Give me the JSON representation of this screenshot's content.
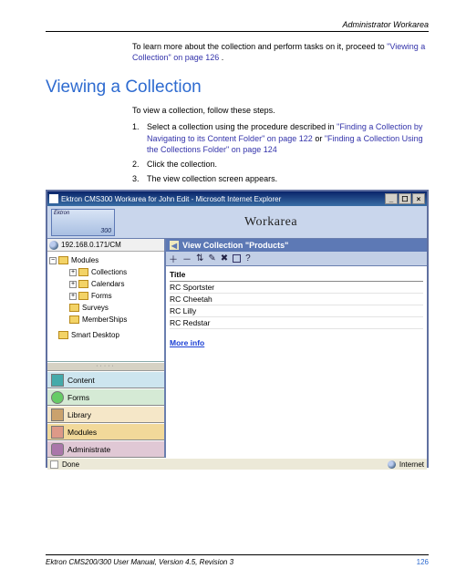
{
  "header": {
    "section": "Administrator Workarea"
  },
  "intro": {
    "prefix": "To learn more about the collection and perform tasks on it, proceed to ",
    "link": "\"Viewing a Collection\" on page 126",
    "suffix": "."
  },
  "heading": "Viewing a Collection",
  "lead": "To view a collection, follow these steps.",
  "steps": [
    {
      "num": "1.",
      "pre": "Select a collection using the procedure described in ",
      "link1": "\"Finding a Collection by Navigating to its Content Folder\" on page 122",
      "mid": " or ",
      "link2": "\"Finding a Collection Using the Collections Folder\" on page 124"
    },
    {
      "num": "2.",
      "text": "Click the collection."
    },
    {
      "num": "3.",
      "text": "The view collection screen appears."
    }
  ],
  "window": {
    "title": "Ektron CMS300 Workarea for John Edit - Microsoft Internet Explorer",
    "banner_title": "Workarea",
    "logo_top": "Ektron",
    "logo_bottom": "300",
    "address": "192.168.0.171/CM",
    "tree": {
      "root": "Modules",
      "items": [
        "Collections",
        "Calendars",
        "Forms",
        "Surveys",
        "MemberShips"
      ],
      "smart": "Smart Desktop"
    },
    "navtabs": {
      "content": "Content",
      "forms": "Forms",
      "library": "Library",
      "modules": "Modules",
      "admin": "Administrate"
    },
    "panel": {
      "title": "View Collection \"Products\"",
      "table_header": "Title",
      "rows": [
        "RC Sportster",
        "RC Cheetah",
        "RC Lilly",
        "RC Redstar"
      ],
      "more": "More info"
    },
    "status": {
      "done": "Done",
      "zone": "Internet"
    }
  },
  "footer": {
    "left": "Ektron CMS200/300 User Manual, Version 4.5, Revision 3",
    "page": "126"
  }
}
